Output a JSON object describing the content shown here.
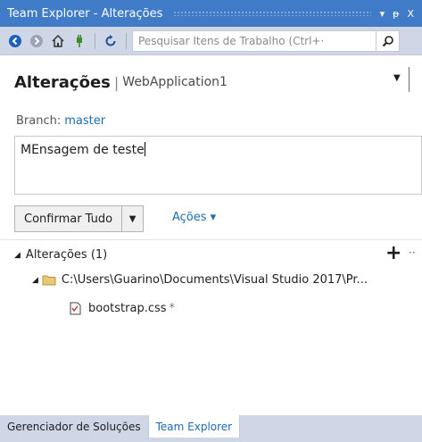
{
  "window": {
    "title": "Team Explorer - Alterações",
    "dropdown_glyph": "▾",
    "pin_glyph": "ᵽ",
    "close_glyph": "X"
  },
  "toolbar": {
    "search_placeholder": "Pesquisar Itens de Trabalho (Ctrl+·",
    "icons": [
      "back-icon",
      "forward-icon",
      "home-icon",
      "connect-icon",
      "refresh-icon",
      "search-icon"
    ]
  },
  "header": {
    "title": "Alterações",
    "separator": "|",
    "repository": "WebApplication1"
  },
  "branch": {
    "label": "Branch:",
    "value": "master"
  },
  "commit": {
    "message": "MEnsagem de teste",
    "commit_all_label": "Confirmar Tudo",
    "actions_label": "Ações ▾"
  },
  "changes": {
    "section_label": "Alterações (1)",
    "add_glyph": "+",
    "more_glyph": "··",
    "folder_path": "C:\\Users\\Guarino\\Documents\\Visual Studio 2017\\Pr...",
    "file_name": "bootstrap.css",
    "file_status": "*"
  },
  "bottom_tabs": [
    {
      "label": "Gerenciador de Soluções",
      "active": false
    },
    {
      "label": "Team Explorer",
      "active": true
    }
  ],
  "colors": {
    "accent": "#3f7bc7",
    "link": "#1e6bb8",
    "toolbar_bg": "#cfd6e5"
  }
}
